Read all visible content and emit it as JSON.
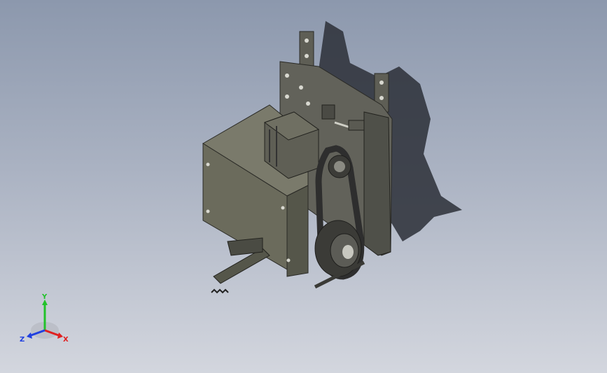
{
  "viewport": {
    "background_top": "#8c98ad",
    "background_bottom": "#d3d6de"
  },
  "model": {
    "body_color": "#6b6b5c",
    "body_top_color": "#7a7a6b",
    "body_side_color": "#55564a",
    "plate_color": "#5a5a52",
    "belt_color": "#2e2e2e",
    "shadow_color": "#2b2f37"
  },
  "triad": {
    "y_label": "Y",
    "x_label": "X",
    "z_label": "Z",
    "y_color": "#22c22a",
    "x_color": "#e02020",
    "z_color": "#2040e0"
  }
}
